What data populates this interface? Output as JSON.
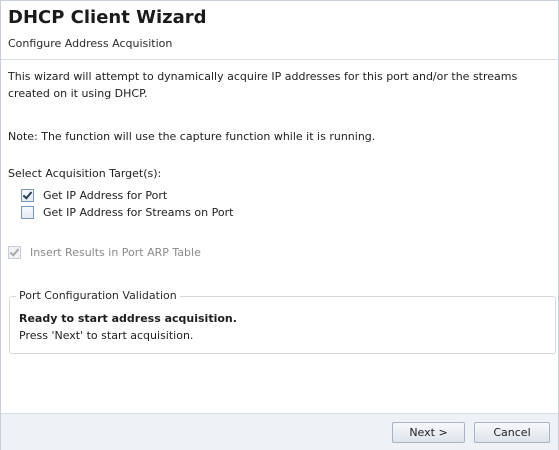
{
  "wizard": {
    "title": "DHCP Client Wizard",
    "subtitle": "Configure Address Acquisition"
  },
  "content": {
    "description": "This wizard will attempt to dynamically acquire IP addresses for this port and/or the streams created on it using DHCP.",
    "note": "Note: The function will use the capture function while it is running.",
    "select_label": "Select Acquisition Target(s):",
    "checkboxes": [
      {
        "label": "Get IP Address for Port",
        "checked": true,
        "enabled": true
      },
      {
        "label": "Get IP Address for Streams on Port",
        "checked": false,
        "enabled": true
      },
      {
        "label": "Insert Results in Port ARP Table",
        "checked": true,
        "enabled": false
      }
    ],
    "validation": {
      "legend": "Port Configuration Validation",
      "status": "Ready to start address acquisition.",
      "message": "Press 'Next' to start acquisition."
    }
  },
  "footer": {
    "next_label": "Next >",
    "cancel_label": "Cancel"
  }
}
